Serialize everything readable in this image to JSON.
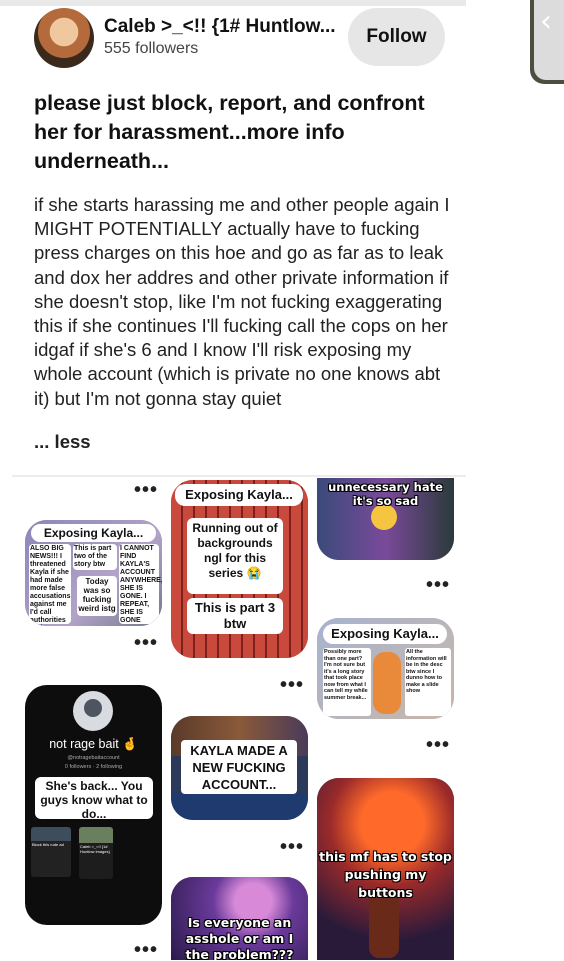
{
  "header": {
    "username": "Caleb >_<!! {1# Huntlow...",
    "followers": "555 followers",
    "follow_label": "Follow",
    "back_glyph": "‹"
  },
  "post": {
    "title": "please just block, report, and confront her for harassment...more info underneath...",
    "body": "if she starts harassing me and other people again I MIGHT POTENTIALLY actually have to fucking press charges on this hoe and go as far as to leak and dox her addres and other private information if she doesn't stop, like I'm not fucking exaggerating this if she continues I'll fucking call the cops on her idgaf if she's 6 and I know I'll risk exposing my whole account (which is private no one knows abt it) but I'm not gonna stay quiet",
    "less_label": "... less"
  },
  "more_label": "•••",
  "pins": {
    "exposing1": {
      "title": "Exposing Kayla...",
      "col1": "ALSO BIG NEWS!!! I threatened Kayla if she had made more false accusations against me I'd call authorities on her",
      "col2": "This is part two of the story btw",
      "col2b": "Today was so fucking weird istg",
      "col3": "I CANNOT FIND KAYLA'S ACCOUNT ANYWHERE, SHE IS GONE. I REPEAT, SHE IS GONE"
    },
    "exposing2": {
      "title": "Exposing Kayla...",
      "line1": "Running out of backgrounds ngl for this series 😭",
      "line2": "This is part 3 btw"
    },
    "hate": {
      "caption": "unnecessary hate it's so sad"
    },
    "exposing3": {
      "title": "Exposing Kayla...",
      "left": "Possibly more than one part? I'm not sure but it's a long story that took place now from what I can tell my while summer break...",
      "right": "All the information will be in the desc btw since I dunno how to make a slide show"
    },
    "ragebait": {
      "name": "not rage bait 🤞",
      "handle": "@notragebaitaccount",
      "stats": "0 followers · 2 following",
      "sticker": "She's back... You guys know what to do...",
      "mini_left": "Block this rude ad",
      "mini_right": "Caleb >_<!! {1# Huntlow images}"
    },
    "kaylanew": {
      "caption": "KAYLA MADE A NEW FUCKING ACCOUNT..."
    },
    "buttons": {
      "caption": "this mf has to stop pushing my buttons"
    },
    "asshole": {
      "caption": "Is everyone an asshole or am I the problem???"
    }
  },
  "colors": {
    "follow_bg": "#e6e6e6",
    "side_button": "#4c4f3f",
    "text": "#111111"
  },
  "icons": [
    "back-chevron-icon",
    "more-dots-icon",
    "avatar"
  ]
}
